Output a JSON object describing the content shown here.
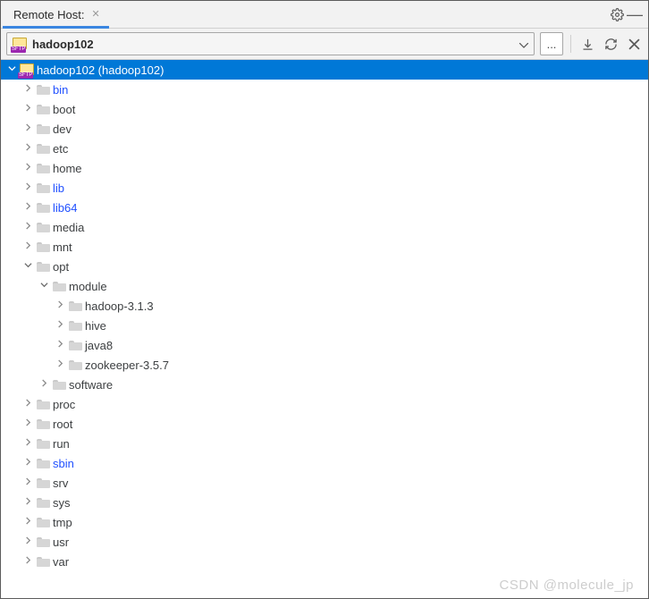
{
  "tab": {
    "title": "Remote Host:"
  },
  "toolbar": {
    "host_label": "hadoop102",
    "sftp_tag": "SFTP",
    "more_label": "...",
    "download_title": "Download",
    "refresh_title": "Refresh",
    "close_title": "Disconnect"
  },
  "root": {
    "label": "hadoop102 (hadoop102)",
    "sftp_tag": "SFTP"
  },
  "tree": [
    {
      "d": 1,
      "label": "bin",
      "link": true,
      "exp": false
    },
    {
      "d": 1,
      "label": "boot",
      "link": false,
      "exp": false
    },
    {
      "d": 1,
      "label": "dev",
      "link": false,
      "exp": false
    },
    {
      "d": 1,
      "label": "etc",
      "link": false,
      "exp": false
    },
    {
      "d": 1,
      "label": "home",
      "link": false,
      "exp": false
    },
    {
      "d": 1,
      "label": "lib",
      "link": true,
      "exp": false
    },
    {
      "d": 1,
      "label": "lib64",
      "link": true,
      "exp": false
    },
    {
      "d": 1,
      "label": "media",
      "link": false,
      "exp": false
    },
    {
      "d": 1,
      "label": "mnt",
      "link": false,
      "exp": false
    },
    {
      "d": 1,
      "label": "opt",
      "link": false,
      "exp": true
    },
    {
      "d": 2,
      "label": "module",
      "link": false,
      "exp": true
    },
    {
      "d": 3,
      "label": "hadoop-3.1.3",
      "link": false,
      "exp": false
    },
    {
      "d": 3,
      "label": "hive",
      "link": false,
      "exp": false
    },
    {
      "d": 3,
      "label": "java8",
      "link": false,
      "exp": false
    },
    {
      "d": 3,
      "label": "zookeeper-3.5.7",
      "link": false,
      "exp": false
    },
    {
      "d": 2,
      "label": "software",
      "link": false,
      "exp": false
    },
    {
      "d": 1,
      "label": "proc",
      "link": false,
      "exp": false
    },
    {
      "d": 1,
      "label": "root",
      "link": false,
      "exp": false
    },
    {
      "d": 1,
      "label": "run",
      "link": false,
      "exp": false
    },
    {
      "d": 1,
      "label": "sbin",
      "link": true,
      "exp": false
    },
    {
      "d": 1,
      "label": "srv",
      "link": false,
      "exp": false
    },
    {
      "d": 1,
      "label": "sys",
      "link": false,
      "exp": false
    },
    {
      "d": 1,
      "label": "tmp",
      "link": false,
      "exp": false
    },
    {
      "d": 1,
      "label": "usr",
      "link": false,
      "exp": false
    },
    {
      "d": 1,
      "label": "var",
      "link": false,
      "exp": false
    }
  ],
  "watermark": "CSDN @molecule_jp"
}
